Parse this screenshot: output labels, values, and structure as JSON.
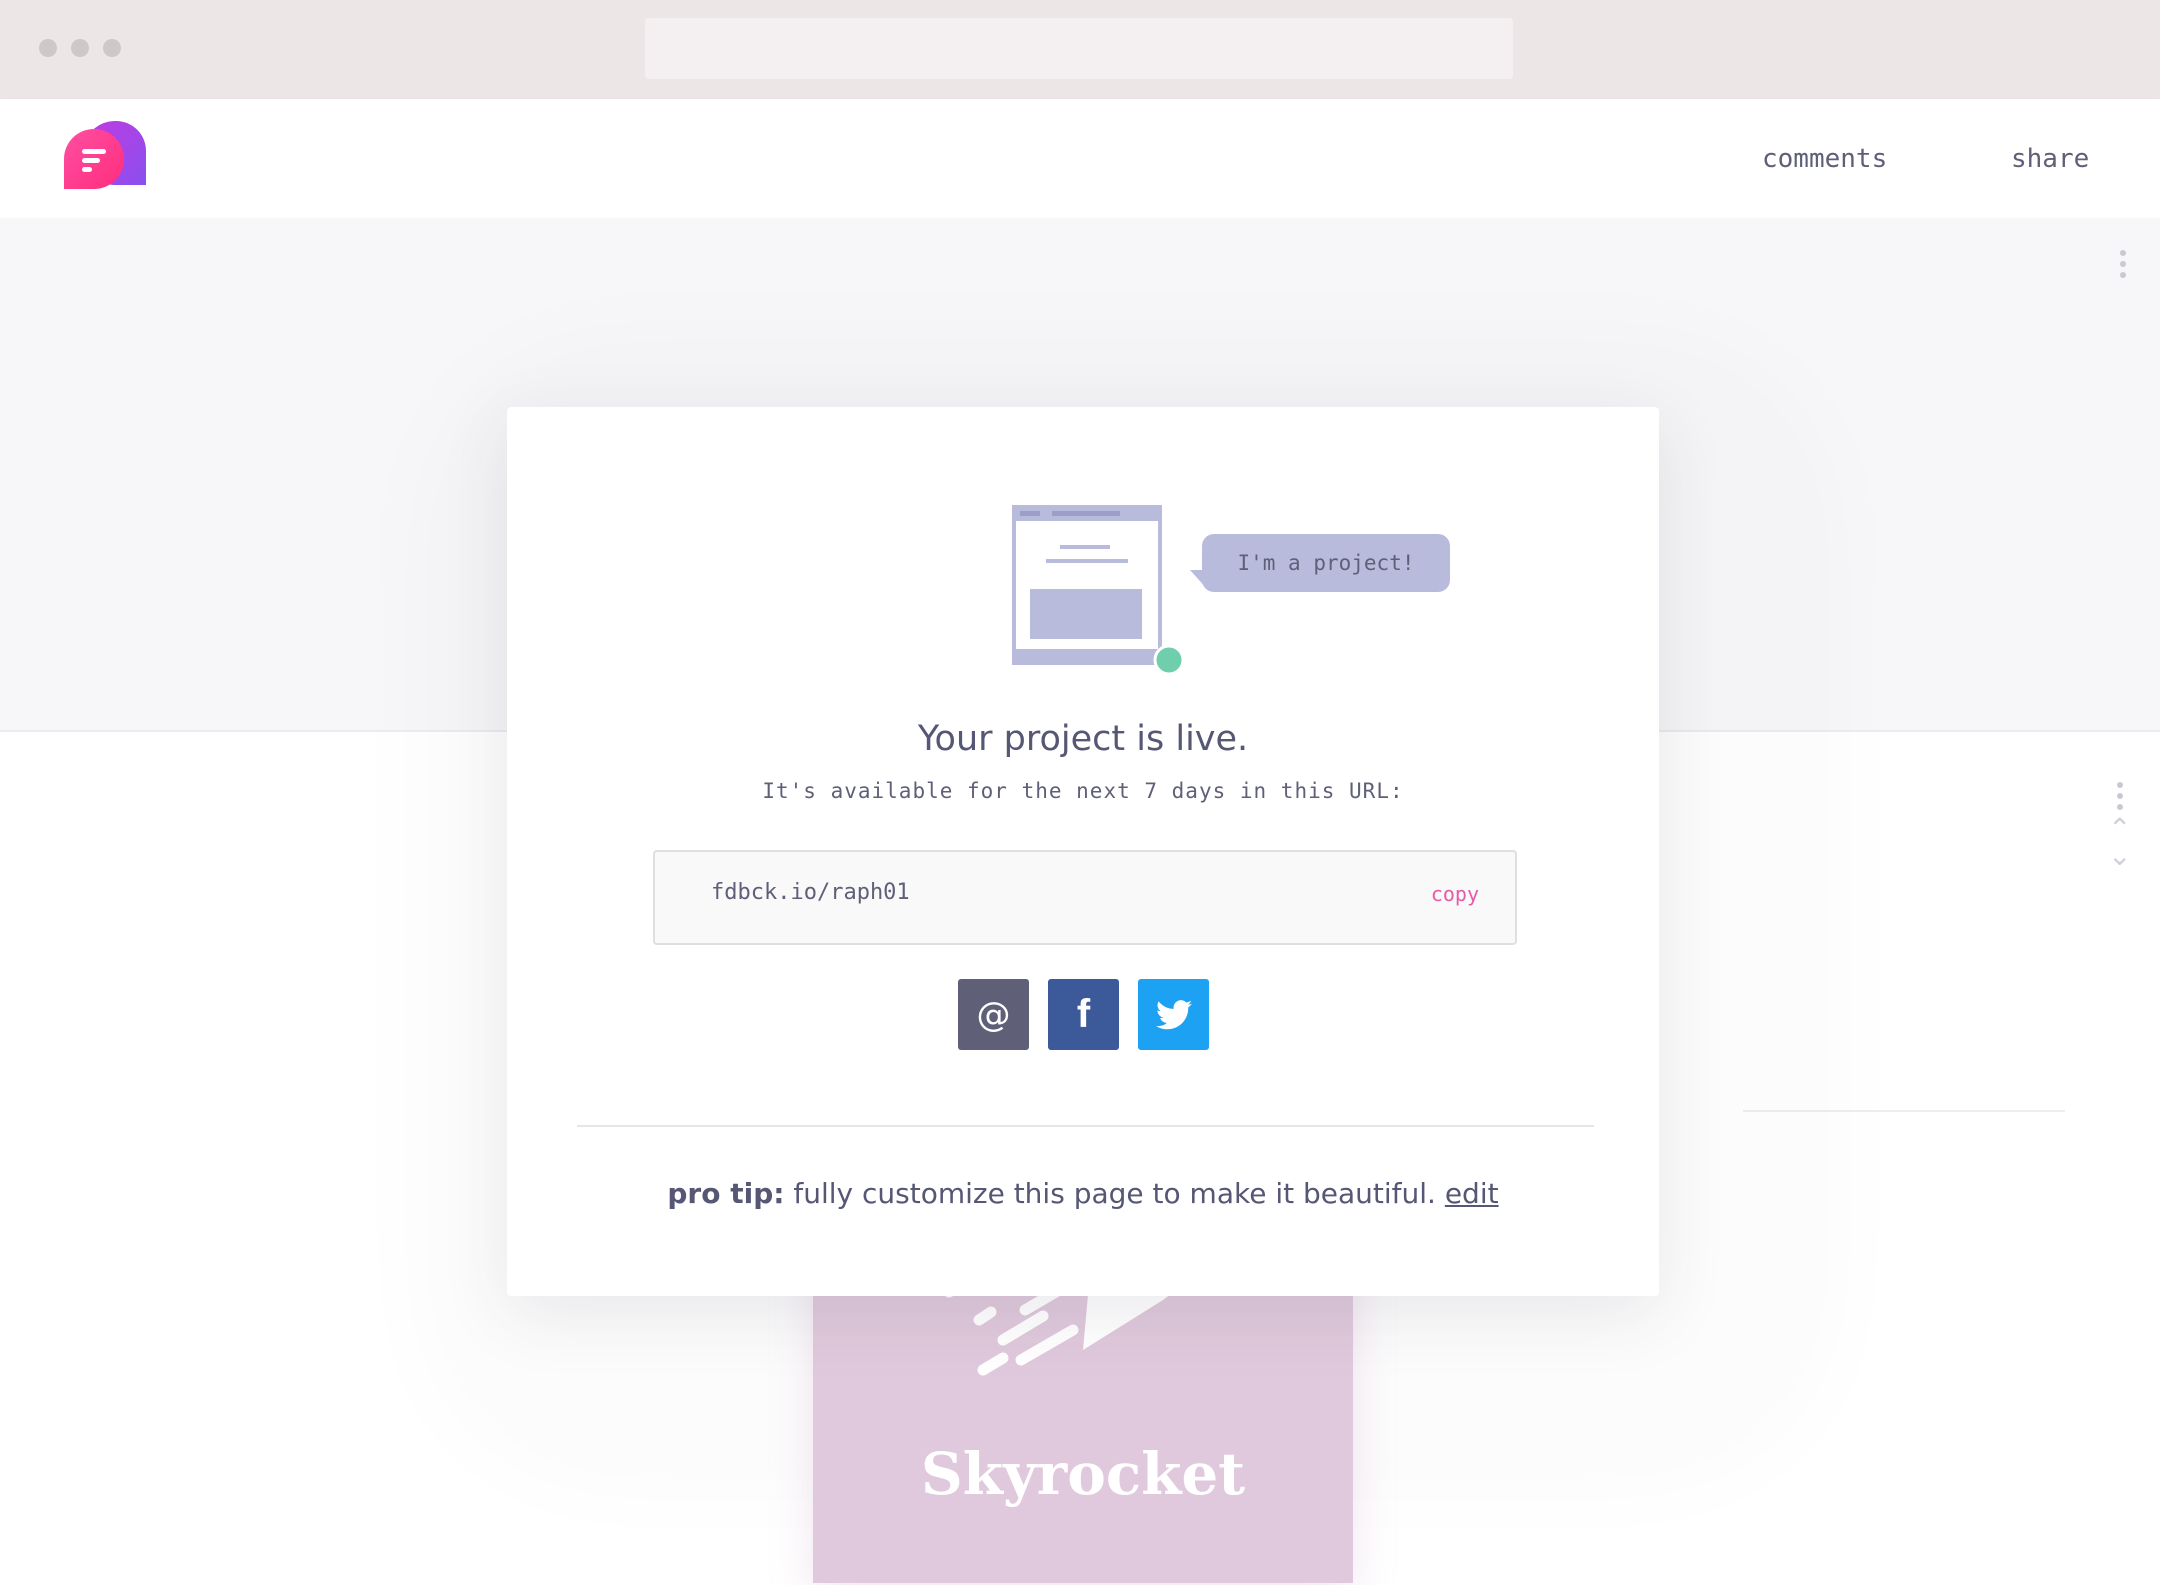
{
  "header": {
    "nav_comments": "comments",
    "nav_share": "share"
  },
  "modal": {
    "bubble_text": "I'm a project!",
    "headline": "Your project is live.",
    "subline": "It's available for the next 7 days in this URL:",
    "url_value": "fdbck.io/raph01",
    "copy_label": "copy",
    "share_buttons": [
      {
        "icon": "at-icon",
        "color": "#5f6078"
      },
      {
        "icon": "facebook-icon",
        "color": "#3c5a99"
      },
      {
        "icon": "twitter-icon",
        "color": "#1da1f2"
      }
    ],
    "tip_label": "pro tip:",
    "tip_text": " fully customize this page to make it beautiful. ",
    "tip_link": "edit"
  },
  "background_card": {
    "title": "Skyrocket"
  },
  "colors": {
    "accent_pink": "#e65aa8",
    "status_green": "#6fcfad",
    "bubble": "#b9bbdd"
  }
}
